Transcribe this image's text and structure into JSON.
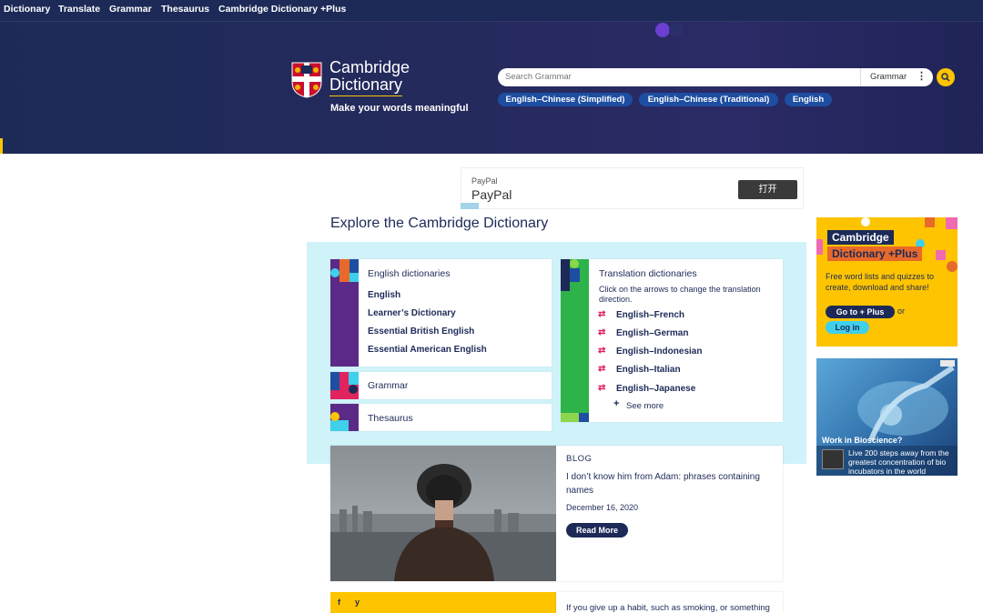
{
  "topnav": {
    "items": [
      "Dictionary",
      "Translate",
      "Grammar",
      "Thesaurus",
      "Cambridge Dictionary +Plus"
    ]
  },
  "header": {
    "logo_line1": "Cambridge",
    "logo_line2": "Dictionary",
    "tagline": "Make your words meaningful",
    "search_placeholder": "Search Grammar",
    "search_dropdown": "Grammar",
    "lang_pills": [
      "English–Chinese (Simplified)",
      "English–Chinese (Traditional)",
      "English"
    ]
  },
  "ad": {
    "small": "PayPal",
    "big": "PayPal",
    "button": "打开"
  },
  "explore": {
    "title": "Explore the Cambridge Dictionary",
    "english_card": {
      "title": "English dictionaries",
      "links": [
        "English",
        "Learner’s Dictionary",
        "Essential British English",
        "Essential American English"
      ]
    },
    "grammar_label": "Grammar",
    "thesaurus_label": "Thesaurus",
    "translation_card": {
      "title": "Translation dictionaries",
      "description": "Click on the arrows to change the translation direction.",
      "links": [
        "English–French",
        "English–German",
        "English–Indonesian",
        "English–Italian",
        "English–Japanese"
      ],
      "see_more": "See more"
    }
  },
  "plus_ad": {
    "label1": "Cambridge",
    "label2": "Dictionary +Plus",
    "description": "Free word lists and quizzes to create, download and share!",
    "go_button": "Go to + Plus",
    "or_text": "or",
    "login_button": "Log in"
  },
  "bio_ad": {
    "title": "Work in Bioscience?",
    "description": "Live 200 steps away from the greatest concentration of bio incubators in the world"
  },
  "blog": {
    "label": "BLOG",
    "title": "I don’t know him from Adam: phrases containing names",
    "date": "December 16, 2020",
    "read_more": "Read More"
  },
  "bottom": {
    "social": [
      "f",
      "y"
    ],
    "text": "If you give up a habit, such as smoking, or something"
  },
  "colors": {
    "navy": "#1d2a57",
    "yellow": "#fec400",
    "blue_pill": "#1d4ea1",
    "cyan_bg": "#d0f3fa"
  }
}
